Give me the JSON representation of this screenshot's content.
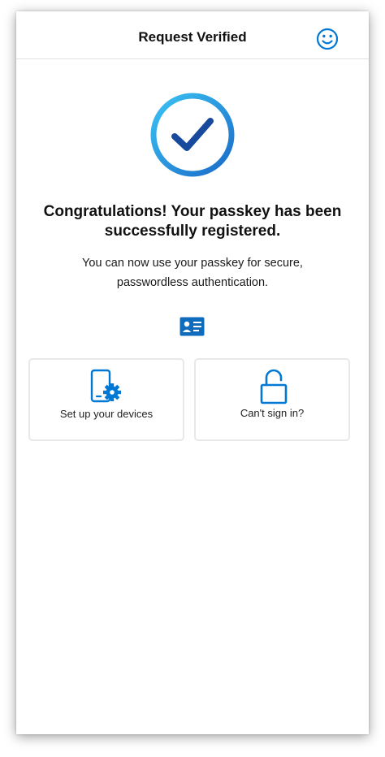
{
  "header": {
    "title": "Request Verified",
    "feedback_icon": "smiley-icon"
  },
  "success": {
    "icon": "check-circle-icon",
    "headline": "Congratulations! Your passkey has been successfully registered.",
    "message": "You can now use your passkey for secure, passwordless authentication."
  },
  "id_card_icon": "id-card-icon",
  "actions": [
    {
      "label": "Set up your devices",
      "icon": "phone-gear-icon"
    },
    {
      "label": "Can't sign in?",
      "icon": "unlock-icon"
    }
  ],
  "colors": {
    "accent_blue": "#0078d4",
    "circle_gradient_start": "#35b8f0",
    "circle_gradient_end": "#1c6fcc",
    "check_dark": "#174a9c",
    "card_border": "#e8e8e8"
  }
}
